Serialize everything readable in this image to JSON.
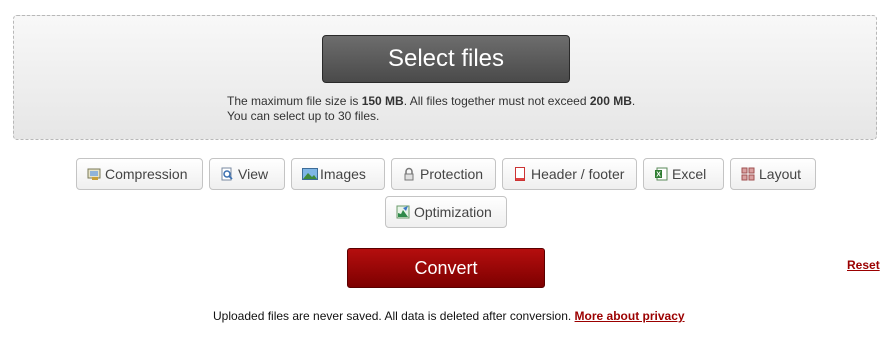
{
  "upload": {
    "select_label": "Select files",
    "limit_prefix": "The maximum file size is ",
    "max_file_size": "150 MB",
    "limit_middle": ". All files together must not exceed ",
    "max_total_size": "200 MB",
    "limit_suffix": ".",
    "max_files_text": "You can select up to 30 files."
  },
  "options": [
    {
      "label": "Compression",
      "icon": "compression-icon"
    },
    {
      "label": "View",
      "icon": "view-icon"
    },
    {
      "label": "Images",
      "icon": "images-icon"
    },
    {
      "label": "Protection",
      "icon": "lock-icon"
    },
    {
      "label": "Header / footer",
      "icon": "header-footer-icon"
    },
    {
      "label": "Excel",
      "icon": "excel-icon"
    },
    {
      "label": "Layout",
      "icon": "layout-icon"
    },
    {
      "label": "Optimization",
      "icon": "optimization-icon"
    }
  ],
  "actions": {
    "convert_label": "Convert",
    "reset_label": "Reset"
  },
  "footer": {
    "text": "Uploaded files are never saved. All data is deleted after conversion. ",
    "privacy_link": "More about privacy"
  },
  "colors": {
    "select_button": "#5a5a5a",
    "convert_button": "#9b0000",
    "link": "#9b0000"
  }
}
